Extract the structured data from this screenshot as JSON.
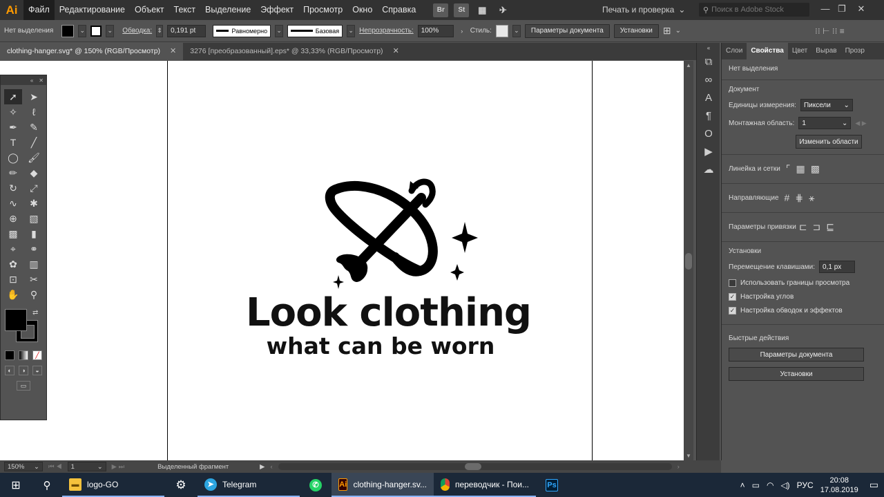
{
  "app": {
    "logo": "Ai"
  },
  "menu": [
    "Файл",
    "Редактирование",
    "Объект",
    "Текст",
    "Выделение",
    "Эффект",
    "Просмотр",
    "Окно",
    "Справка"
  ],
  "menu_buttons": [
    "Br",
    "St"
  ],
  "workspace": "Печать и проверка",
  "search_placeholder": "Поиск в Adobe Stock",
  "control": {
    "selection": "Нет выделения",
    "stroke_label": "Обводка:",
    "stroke_value": "0,191 pt",
    "profile1": "Равномерно",
    "profile2": "Базовая",
    "opacity_label": "Непрозрачность:",
    "opacity_value": "100%",
    "style_label": "Стиль:",
    "doc_params": "Параметры документа",
    "settings": "Установки"
  },
  "tabs": [
    {
      "label": "clothing-hanger.svg* @ 150% (RGB/Просмотр)"
    },
    {
      "label": "3276 [преобразованный].eps* @ 33,33% (RGB/Просмотр)"
    }
  ],
  "artwork": {
    "title": "Look clothing",
    "subtitle": "what can be worn"
  },
  "properties": {
    "tabs": [
      "Слои",
      "Свойства",
      "Цвет",
      "Вырав",
      "Прозр"
    ],
    "no_selection": "Нет выделения",
    "document": "Документ",
    "units_label": "Единицы измерения:",
    "units_value": "Пиксели",
    "artboard_label": "Монтажная область:",
    "artboard_value": "1",
    "edit_artboards": "Изменить области",
    "rulers_grids": "Линейка и сетки",
    "guides": "Направляющие",
    "snap": "Параметры привязки",
    "prefs": "Установки",
    "keyboard_inc_label": "Перемещение клавишами:",
    "keyboard_inc_value": "0,1 px",
    "opt_preview_bounds": "Использовать границы просмотра",
    "opt_corners": "Настройка углов",
    "opt_strokes": "Настройка обводок и эффектов",
    "quick_actions": "Быстрые действия",
    "qa_doc_params": "Параметры документа",
    "qa_settings": "Установки"
  },
  "status": {
    "zoom": "150%",
    "artboard": "1",
    "info": "Выделенный фрагмент"
  },
  "taskbar": {
    "items": [
      "logo-GO",
      "Telegram",
      "clothing-hanger.sv...",
      "переводчик - Пои..."
    ],
    "lang": "РУС",
    "time": "20:08",
    "date": "17.08.2019"
  },
  "colors": {
    "accent": "#ff9a00",
    "chrome_dark": "#323232",
    "panel": "#535353",
    "taskbar": "#1b2838"
  }
}
